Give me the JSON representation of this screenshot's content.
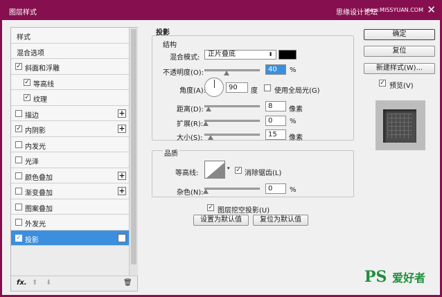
{
  "window": {
    "title": "图层样式",
    "watermark": "思缘设计论坛",
    "watermark_site": "www.MISSYUAN.COM",
    "close_glyph": "✕"
  },
  "sidebar": {
    "items": [
      {
        "label": "样式",
        "checkbox": false,
        "plus": false
      },
      {
        "label": "混合选项",
        "checkbox": false,
        "plus": false
      },
      {
        "label": "斜面和浮雕",
        "checkbox": true,
        "checked": true,
        "plus": false
      },
      {
        "label": "等高线",
        "checkbox": true,
        "checked": true,
        "sub": true,
        "plus": false
      },
      {
        "label": "纹理",
        "checkbox": true,
        "checked": true,
        "sub": true,
        "plus": false
      },
      {
        "label": "描边",
        "checkbox": true,
        "checked": false,
        "plus": true
      },
      {
        "label": "内阴影",
        "checkbox": true,
        "checked": true,
        "plus": true
      },
      {
        "label": "内发光",
        "checkbox": true,
        "checked": false,
        "plus": false
      },
      {
        "label": "光泽",
        "checkbox": true,
        "checked": false,
        "plus": false
      },
      {
        "label": "颜色叠加",
        "checkbox": true,
        "checked": false,
        "plus": true
      },
      {
        "label": "渐变叠加",
        "checkbox": true,
        "checked": false,
        "plus": true
      },
      {
        "label": "图案叠加",
        "checkbox": true,
        "checked": false,
        "plus": false
      },
      {
        "label": "外发光",
        "checkbox": true,
        "checked": false,
        "plus": false
      },
      {
        "label": "投影",
        "checkbox": true,
        "checked": true,
        "plus": true,
        "active": true
      }
    ],
    "footer": {
      "fx": "fx.",
      "up": "⬆",
      "down": "⬇",
      "trash": "🗑"
    }
  },
  "drop_shadow": {
    "title": "投影",
    "structure": {
      "title": "结构",
      "blend_mode_label": "混合模式:",
      "blend_mode_value": "正片叠底",
      "opacity_label": "不透明度(O):",
      "opacity_value": "40",
      "opacity_unit": "%",
      "angle_label": "角度(A):",
      "angle_value": "90",
      "angle_unit": "度",
      "global_light_label": "使用全局光(G)",
      "distance_label": "距离(D):",
      "distance_value": "8",
      "distance_unit": "像素",
      "spread_label": "扩展(R):",
      "spread_value": "0",
      "spread_unit": "%",
      "size_label": "大小(S):",
      "size_value": "15",
      "size_unit": "像素"
    },
    "quality": {
      "title": "品质",
      "contour_label": "等高线:",
      "antialias_label": "消除锯齿(L)",
      "noise_label": "杂色(N):",
      "noise_value": "0",
      "noise_unit": "%"
    },
    "knockout_label": "图层挖空投影(U)",
    "make_default": "设置为默认值",
    "reset_default": "复位为默认值"
  },
  "buttons": {
    "ok": "确定",
    "reset": "复位",
    "new_style": "新建样式(W)...",
    "preview_label": "预览(V)"
  },
  "logo": {
    "main": "PS",
    "sub": "爱好者"
  }
}
